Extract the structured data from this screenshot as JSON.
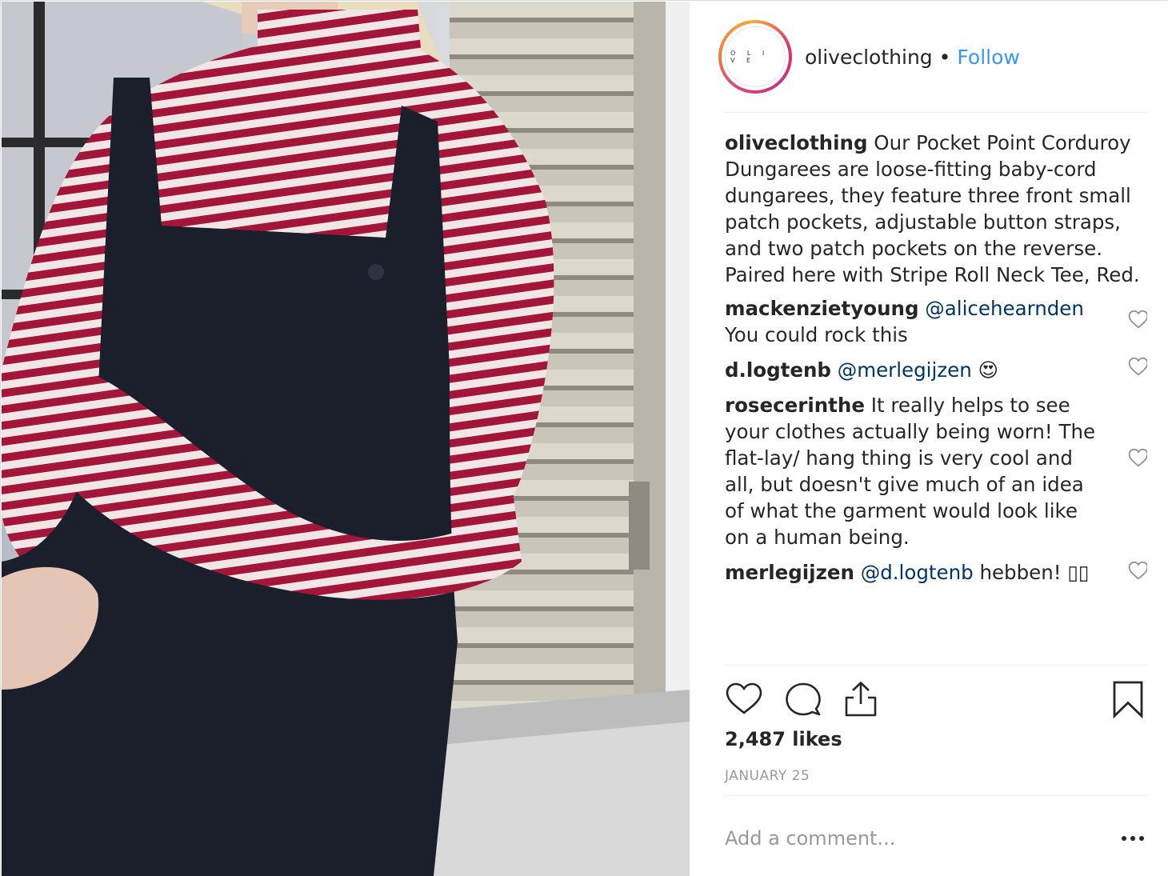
{
  "post": {
    "image_alt": "Woman in red striped roll neck tee and dark corduroy dungarees sitting by a window with shutters"
  },
  "header": {
    "avatar_text": "O L I V E",
    "username": "oliveclothing",
    "separator": "•",
    "follow_label": "Follow"
  },
  "caption": {
    "username": "oliveclothing",
    "text": " Our Pocket Point Corduroy Dungarees are loose-fitting baby-cord dungarees, they feature three front small patch pockets, adjustable button straps, and two patch pockets on the reverse. Paired here with Stripe Roll Neck Tee, Red."
  },
  "comments": [
    {
      "username": "mackenzietyoung",
      "mention": "@alicehearnden",
      "text": " You could rock this"
    },
    {
      "username": "d.logtenb",
      "mention": "@merlegijzen",
      "text": " 😍"
    },
    {
      "username": "rosecerinthe",
      "mention": "",
      "text": " It really helps to see your clothes actually being worn! The flat-lay/ hang thing is very cool and all, but doesn't give much of an idea of what the garment would look like on a human being."
    },
    {
      "username": "merlegijzen",
      "mention": "@d.logtenb",
      "text": " hebben! ▯▯"
    }
  ],
  "actions": {
    "like_icon": "heart-icon",
    "comment_icon": "comment-bubble-icon",
    "share_icon": "share-upload-icon",
    "save_icon": "bookmark-icon"
  },
  "likes": "2,487 likes",
  "date": "JANUARY 25",
  "add_comment": {
    "placeholder": "Add a comment...",
    "value": ""
  },
  "more_icon": "more-options-icon",
  "colors": {
    "link": "#3897f0",
    "mention": "#003569",
    "muted": "#999999",
    "border": "#dbdbdb"
  }
}
